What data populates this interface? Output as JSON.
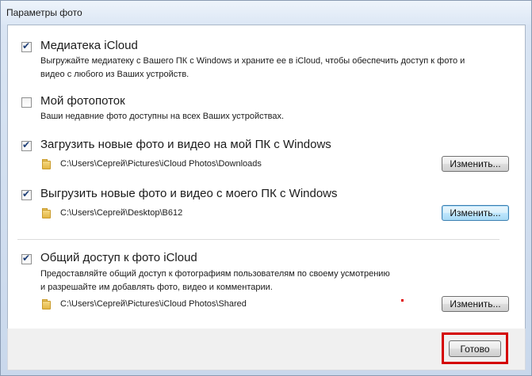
{
  "window": {
    "title": "Параметры фото"
  },
  "sections": [
    {
      "checked": true,
      "heading": "Медиатека iCloud",
      "desc_line1": "Выгружайте медиатеку с Вашего ПК с Windows и храните ее в iCloud, чтобы обеспечить доступ к фото и",
      "desc_line2": "видео с любого из Ваших устройств."
    },
    {
      "checked": false,
      "heading": "Мой фотопоток",
      "desc_line1": "Ваши недавние фото доступны на всех Ваших устройствах."
    },
    {
      "checked": true,
      "heading": "Загрузить новые фото и видео на мой ПК с Windows",
      "path": "C:\\Users\\Сергей\\Pictures\\iCloud Photos\\Downloads",
      "button": "Изменить..."
    },
    {
      "checked": true,
      "heading": "Выгрузить новые фото и видео с моего ПК с Windows",
      "path": "C:\\Users\\Сергей\\Desktop\\B612",
      "button": "Изменить..."
    },
    {
      "checked": true,
      "heading": "Общий доступ к фото iCloud",
      "desc_line1": "Предоставляйте общий доступ к фотографиям пользователям по своему усмотрению",
      "desc_line2": "и разрешайте им добавлять фото, видео и комментарии.",
      "path": "C:\\Users\\Сергей\\Pictures\\iCloud Photos\\Shared",
      "button": "Изменить..."
    }
  ],
  "footer": {
    "done_button": "Готово"
  },
  "colors": {
    "highlight": "#d40000",
    "checkmark": "#1f3f77",
    "window_bg": "#d1deef"
  },
  "icons": {
    "checkbox_mark": "✔",
    "folder": "folder-icon"
  }
}
